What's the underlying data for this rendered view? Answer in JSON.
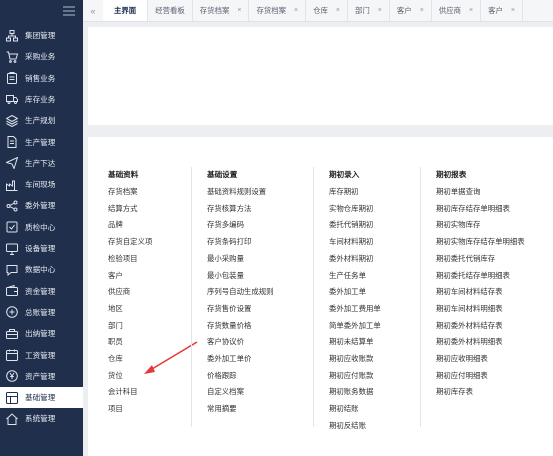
{
  "sidebar": {
    "toggle_icon": "hamburger-icon",
    "items": [
      {
        "label": "集团管理",
        "icon": "org-tree-icon"
      },
      {
        "label": "采购业务",
        "icon": "cart-icon"
      },
      {
        "label": "销售业务",
        "icon": "clipboard-icon"
      },
      {
        "label": "库存业务",
        "icon": "truck-icon"
      },
      {
        "label": "生产规划",
        "icon": "layers-icon"
      },
      {
        "label": "生产管理",
        "icon": "document-icon"
      },
      {
        "label": "生产下达",
        "icon": "send-icon"
      },
      {
        "label": "车间现场",
        "icon": "factory-icon"
      },
      {
        "label": "委外管理",
        "icon": "share-icon"
      },
      {
        "label": "质检中心",
        "icon": "shield-check-icon"
      },
      {
        "label": "设备管理",
        "icon": "monitor-icon"
      },
      {
        "label": "数据中心",
        "icon": "chat-icon"
      },
      {
        "label": "资金管理",
        "icon": "wallet-icon"
      },
      {
        "label": "总账管理",
        "icon": "ledger-icon"
      },
      {
        "label": "出纳管理",
        "icon": "cashbox-icon"
      },
      {
        "label": "工资管理",
        "icon": "calendar-icon"
      },
      {
        "label": "资产管理",
        "icon": "yen-circle-icon"
      },
      {
        "label": "基础管理",
        "icon": "grid-icon",
        "active": true
      },
      {
        "label": "系统管理",
        "icon": "home-icon"
      }
    ]
  },
  "tabs": {
    "nav_icon": "double-chevron-left-icon",
    "items": [
      {
        "label": "主界面",
        "active": true,
        "closable": false
      },
      {
        "label": "经营看板",
        "active": false,
        "closable": false
      },
      {
        "label": "存货档案",
        "active": false,
        "closable": true
      },
      {
        "label": "存货档案",
        "active": false,
        "closable": true
      },
      {
        "label": "仓库",
        "active": false,
        "closable": true
      },
      {
        "label": "部门",
        "active": false,
        "closable": true
      },
      {
        "label": "客户",
        "active": false,
        "closable": true
      },
      {
        "label": "供应商",
        "active": false,
        "closable": true
      },
      {
        "label": "客户",
        "active": false,
        "closable": true
      }
    ],
    "close_glyph": "×"
  },
  "menu": {
    "columns": [
      {
        "title": "基础资料",
        "items": [
          "存货档案",
          "结算方式",
          "品牌",
          "存货自定义项",
          "检验项目",
          "客户",
          "供应商",
          "地区",
          "部门",
          "职员",
          "仓库",
          "货位",
          "会计科目",
          "项目"
        ]
      },
      {
        "title": "基础设置",
        "items": [
          "基础资料规则设置",
          "存货核算方法",
          "存货多编码",
          "存货条码打印",
          "最小采购量",
          "最小包装量",
          "序列号自动生成规则",
          "存货售价设置",
          "存货数量价格",
          "客户协议价",
          "委外加工单价",
          "价格跟踪",
          "自定义档案",
          "常用摘要"
        ]
      },
      {
        "title": "期初录入",
        "items": [
          "库存期初",
          "实物仓库期初",
          "委托代销期初",
          "车间材料期初",
          "委外材料期初",
          "生产任务单",
          "委外加工单",
          "委外加工费用单",
          "简单委外加工单",
          "期初未结算单",
          "期初应收账款",
          "期初应付账款",
          "期初账务数据",
          "期初结账",
          "期初反结账"
        ]
      },
      {
        "title": "期初报表",
        "items": [
          "期初单据查询",
          "期初库存结存单明细表",
          "期初实物库存",
          "期初实物库存结存单明细表",
          "期初委托代销库存",
          "期初委托结存单明细表",
          "期初车间材料结存表",
          "期初车间材料明细表",
          "期初委外材料结存表",
          "期初委外材料明细表",
          "期初应收明细表",
          "期初应付明细表",
          "期初库存表"
        ]
      }
    ]
  },
  "annotation": {
    "type": "red-arrow",
    "target": "会计科目",
    "color": "#e53935"
  },
  "colors": {
    "sidebar_bg": "#1f2f4c",
    "content_bg": "#eceef2",
    "accent": "#1f2f4c",
    "arrow": "#e53935"
  }
}
